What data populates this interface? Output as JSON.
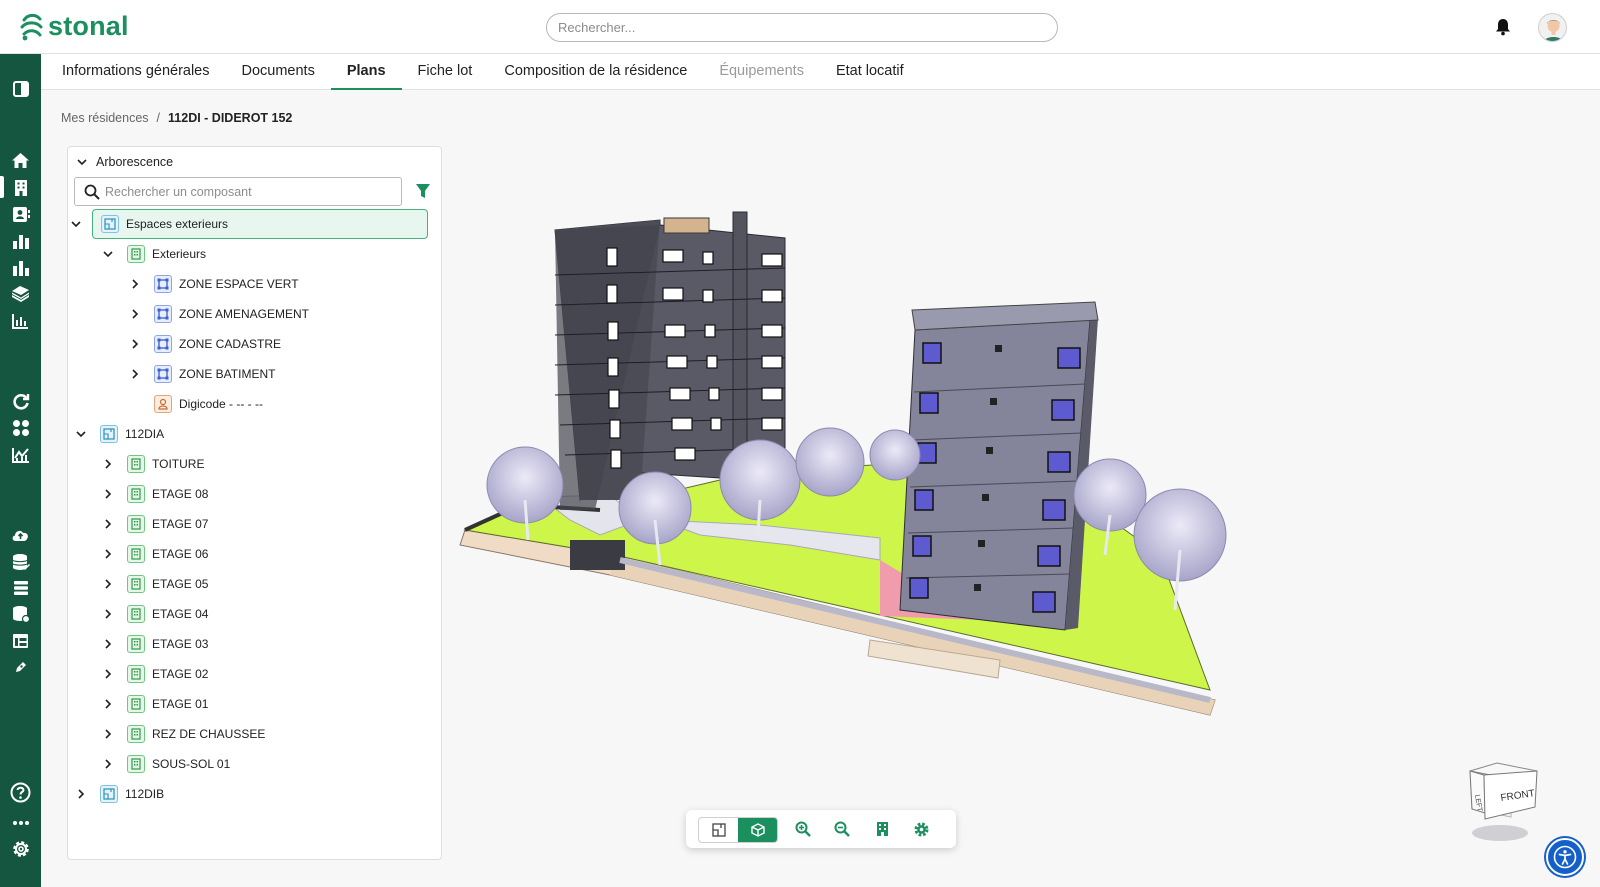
{
  "app": {
    "brand": "stonal"
  },
  "header": {
    "search_placeholder": "Rechercher..."
  },
  "tabs": [
    {
      "label": "Informations générales"
    },
    {
      "label": "Documents"
    },
    {
      "label": "Plans"
    },
    {
      "label": "Fiche lot"
    },
    {
      "label": "Composition de la résidence"
    },
    {
      "label": "Équipements"
    },
    {
      "label": "Etat locatif"
    }
  ],
  "breadcrumb": {
    "root": "Mes résidences",
    "separator": "/",
    "current": "112DI - DIDEROT 152"
  },
  "tree": {
    "header": "Arborescence",
    "search_placeholder": "Rechercher un composant",
    "items": [
      {
        "label": "Espaces exterieurs"
      },
      {
        "label": "Exterieurs"
      },
      {
        "label": "ZONE ESPACE VERT"
      },
      {
        "label": "ZONE AMENAGEMENT"
      },
      {
        "label": "ZONE CADASTRE"
      },
      {
        "label": "ZONE BATIMENT"
      },
      {
        "label": "Digicode - -- - --"
      },
      {
        "label": "112DIA"
      },
      {
        "label": "TOITURE"
      },
      {
        "label": "ETAGE 08"
      },
      {
        "label": "ETAGE 07"
      },
      {
        "label": "ETAGE 06"
      },
      {
        "label": "ETAGE 05"
      },
      {
        "label": "ETAGE 04"
      },
      {
        "label": "ETAGE 03"
      },
      {
        "label": "ETAGE 02"
      },
      {
        "label": "ETAGE 01"
      },
      {
        "label": "REZ DE CHAUSSEE"
      },
      {
        "label": "SOUS-SOL 01"
      },
      {
        "label": "112DIB"
      }
    ]
  },
  "navcube": {
    "left": "LEFT",
    "front": "FRONT"
  },
  "colors": {
    "brand": "#1b8f5e",
    "sidebar": "#14563f",
    "accessibility": "#1560c8"
  }
}
